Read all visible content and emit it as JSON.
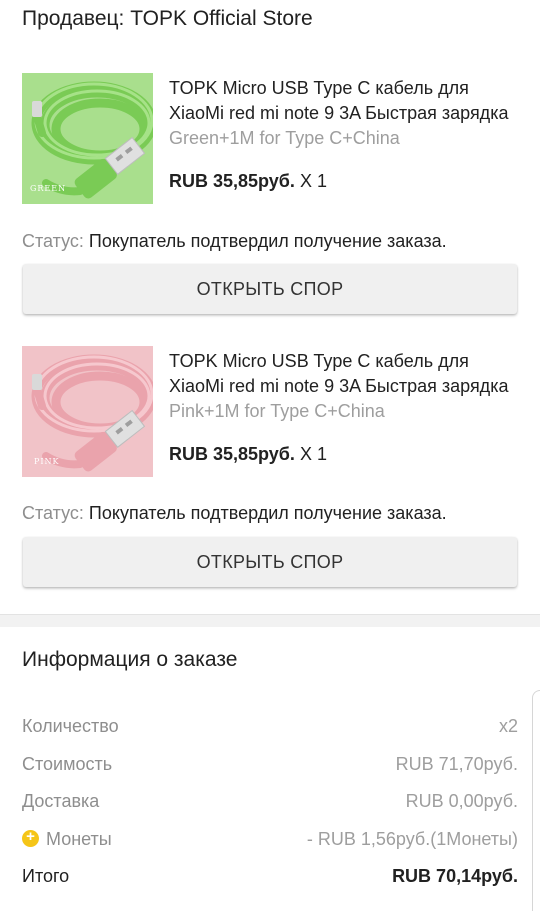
{
  "seller": {
    "text": "Продавец: TOPK Official Store"
  },
  "products": [
    {
      "title": "TOPK Micro USB Type C кабель для XiaoMi red mi note 9 3A Быстрая зарядка",
      "variant": "Green+1M for Type C+China",
      "price": "RUB 35,85руб.",
      "qty": "X 1",
      "image_color": "#8ed56c",
      "image_label": "GREEN",
      "status_label": "Статус:",
      "status_value": "Покупатель подтвердил получение заказа.",
      "button_label": "ОТКРЫТЬ СПОР"
    },
    {
      "title": "TOPK Micro USB Type C кабель для XiaoMi red mi note 9 3A Быстрая зарядка",
      "variant": "Pink+1M for Type C+China",
      "price": "RUB 35,85руб.",
      "qty": "X 1",
      "image_color": "#efb6bd",
      "image_label": "PINK",
      "status_label": "Статус:",
      "status_value": "Покупатель подтвердил получение заказа.",
      "button_label": "ОТКРЫТЬ СПОР"
    }
  ],
  "order_info": {
    "title": "Информация о заказе",
    "rows": {
      "quantity": {
        "label": "Количество",
        "value": "x2"
      },
      "cost": {
        "label": "Стоимость",
        "value": "RUB 71,70руб."
      },
      "delivery": {
        "label": "Доставка",
        "value": "RUB 0,00руб."
      },
      "coins": {
        "label": "Монеты",
        "value": "- RUB 1,56руб.(1Монеты)",
        "icon": "coin-icon"
      },
      "total": {
        "label": "Итого",
        "value": "RUB 70,14руб."
      }
    }
  },
  "colors": {
    "coin": "#f5c518",
    "muted": "#8e8e8e",
    "text": "#212121"
  }
}
